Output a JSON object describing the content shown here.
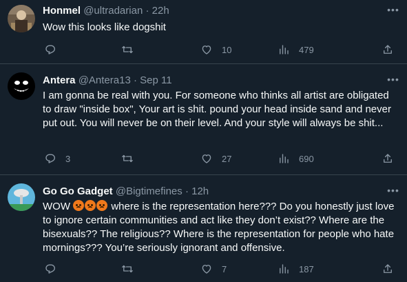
{
  "tweets": [
    {
      "name": "Honmel",
      "handle": "@ultradarian",
      "sep": " · ",
      "time": "22h",
      "text": "Wow this looks like dogshit",
      "counts": {
        "reply": "",
        "retweet": "",
        "like": "10",
        "views": "479"
      }
    },
    {
      "name": "Antera",
      "handle": "@Antera13",
      "sep": " · ",
      "time": "Sep 11",
      "text": "I am gonna be real with you. For someone who thinks all artist are obligated to draw \"inside box\", Your art is shit. pound your head inside sand and never put out. You will never be on their level. And your style will always be shit...",
      "counts": {
        "reply": "3",
        "retweet": "",
        "like": "27",
        "views": "690"
      }
    },
    {
      "name": "Go Go Gadget",
      "handle": "@Bigtimefines",
      "sep": " · ",
      "time": "12h",
      "text_prefix": "WOW",
      "emoji": [
        "angry-face",
        "angry-face",
        "angry-face"
      ],
      "text": "where is the representation here??? Do you honestly just love to ignore certain communities and act like they don’t exist?? Where are the bisexuals?? The religious?? Where is the representation for people who hate mornings??? You’re seriously ignorant and offensive.",
      "counts": {
        "reply": "",
        "retweet": "",
        "like": "7",
        "views": "187"
      }
    }
  ],
  "icons": [
    "reply-icon",
    "retweet-icon",
    "like-icon",
    "views-icon",
    "share-icon",
    "more-icon"
  ],
  "colors": {
    "background": "#15202b",
    "text": "#f7f9f9",
    "muted": "#8b98a5",
    "divider": "#38444d"
  }
}
